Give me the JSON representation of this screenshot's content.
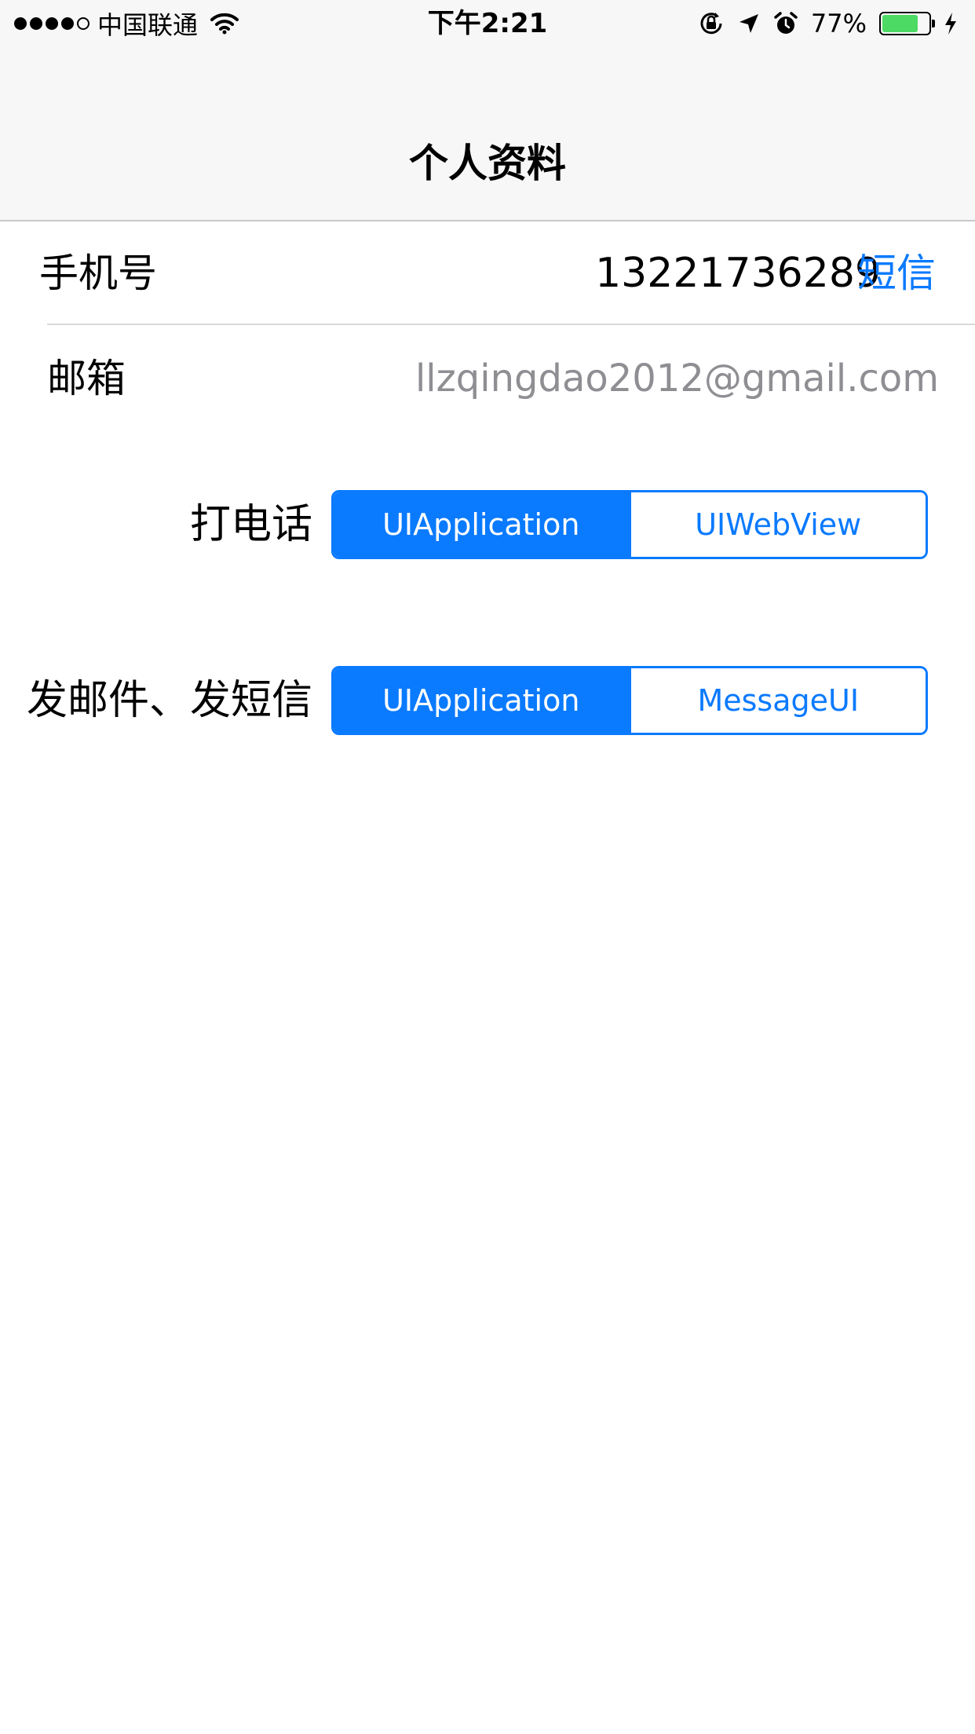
{
  "status_bar": {
    "signal_bars_filled": 4,
    "signal_bars_total": 5,
    "carrier": "中国联通",
    "wifi_icon": "wifi-icon",
    "time": "下午2:21",
    "orientation_lock_icon": "orientation-lock-icon",
    "location_icon": "location-arrow-icon",
    "alarm_icon": "alarm-clock-icon",
    "battery_percent": "77%",
    "battery_level": 0.77,
    "battery_color": "#4cd964",
    "charging_icon": "charging-bolt-icon"
  },
  "nav": {
    "title": "个人资料"
  },
  "phone_row": {
    "label": "手机号",
    "value": "13221736289",
    "sms_link": "短信"
  },
  "email_row": {
    "label": "邮箱",
    "value": "llzqingdao2012@gmail.com"
  },
  "call_control": {
    "label": "打电话",
    "segments": [
      "UIApplication",
      "UIWebView"
    ],
    "selected_index": 0
  },
  "mail_control": {
    "label": "发邮件、发短信",
    "segments": [
      "UIApplication",
      "MessageUI"
    ],
    "selected_index": 0
  },
  "colors": {
    "accent": "#0a7aff",
    "secondary_text": "#8e8e93",
    "bar_background": "#f7f7f7"
  }
}
